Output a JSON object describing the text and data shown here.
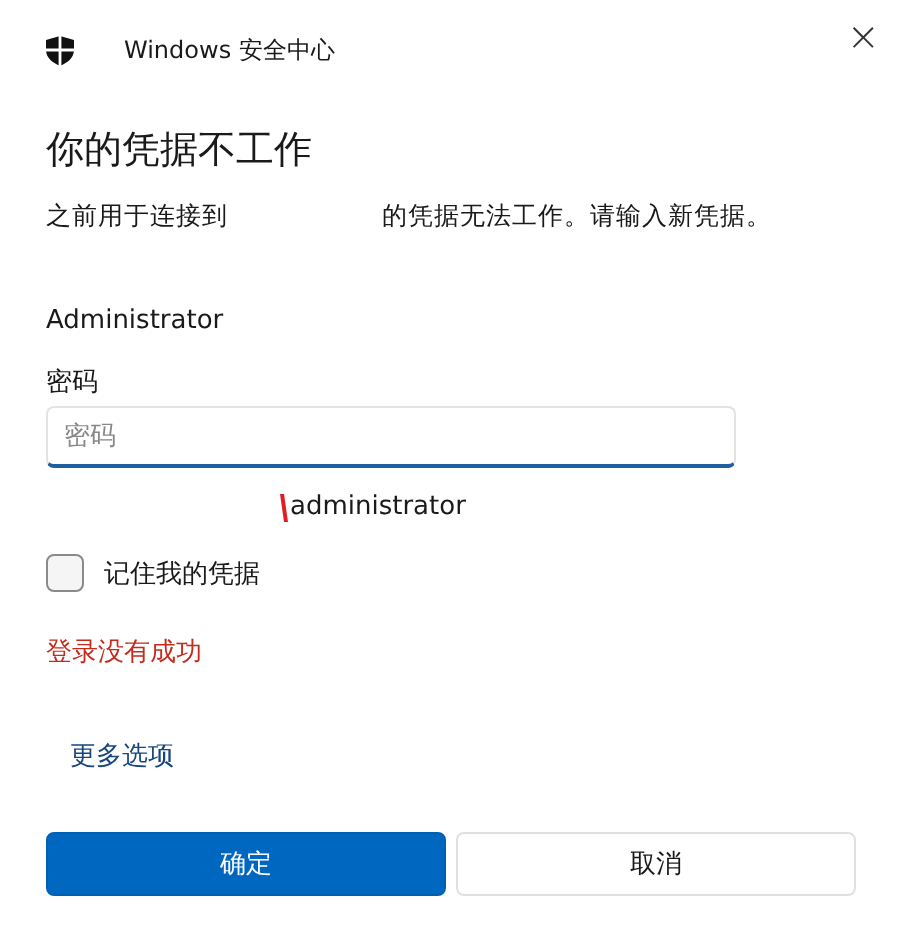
{
  "window": {
    "title": "Windows 安全中心",
    "close": "×"
  },
  "heading": "你的凭据不工作",
  "description": {
    "before": "之前用于连接到",
    "after": "的凭据无法工作。请输入新凭据。"
  },
  "username": "Administrator",
  "password": {
    "label": "密码",
    "placeholder": "密码",
    "focused": true
  },
  "account_hint": "administrator",
  "remember": {
    "label": "记住我的凭据",
    "checked": false
  },
  "error": "登录没有成功",
  "more_options": "更多选项",
  "buttons": [
    {
      "label": "确定",
      "kind": "primary"
    },
    {
      "label": "取消",
      "kind": "secondary"
    }
  ]
}
